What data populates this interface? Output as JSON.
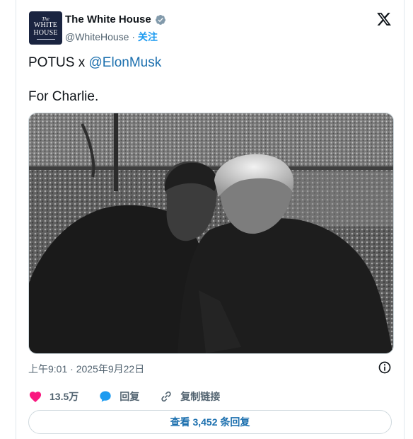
{
  "account": {
    "name": "The White House",
    "handle": "@WhiteHouse",
    "separator": "·",
    "follow_label": "关注",
    "avatar_text": [
      "The",
      "WHITE",
      "HOUSE"
    ]
  },
  "post": {
    "line1_prefix": "POTUS x ",
    "line1_mention": "@ElonMusk",
    "line2": "For Charlie."
  },
  "timestamp": "上午9:01 · 2025年9月22日",
  "actions": {
    "likes": "13.5万",
    "reply_label": "回复",
    "copy_link_label": "复制链接"
  },
  "view_replies_label": "查看 3,452 条回复",
  "colors": {
    "accent": "#1d9bf0",
    "link": "#1b6fae",
    "like": "#f91880",
    "verified": "#829aab"
  },
  "icons": [
    "verified-badge-icon",
    "x-logo-icon",
    "info-icon",
    "heart-icon",
    "reply-icon",
    "link-icon"
  ]
}
